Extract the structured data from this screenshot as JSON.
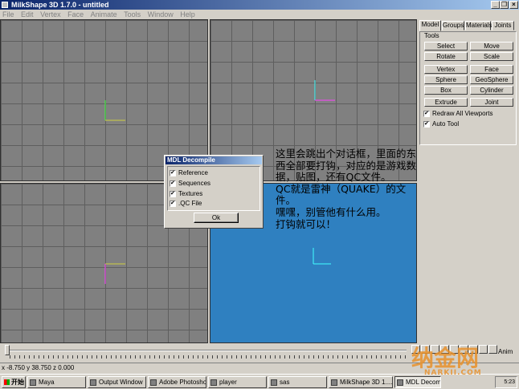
{
  "window": {
    "title": "MilkShape 3D 1.7.0 - untitled",
    "minimize_glyph": "_",
    "restore_glyph": "❐",
    "close_glyph": "×"
  },
  "menu": [
    "File",
    "Edit",
    "Vertex",
    "Face",
    "Animate",
    "Tools",
    "Window",
    "Help"
  ],
  "panel": {
    "tabs": [
      "Model",
      "Groups",
      "Materials",
      "Joints"
    ],
    "active_tab": "Model",
    "tools_label": "Tools",
    "buttons": [
      "Select",
      "Move",
      "Rotate",
      "Scale",
      "Vertex",
      "Face",
      "Sphere",
      "GeoSphere",
      "Box",
      "Cylinder",
      "Extrude",
      "Joint"
    ],
    "checkboxes": [
      {
        "label": "Redraw All Viewports",
        "checked": true
      },
      {
        "label": "Auto Tool",
        "checked": true
      }
    ]
  },
  "dialog": {
    "title": "MDL Decompile",
    "options": [
      {
        "label": "Reference",
        "checked": true
      },
      {
        "label": "Sequences",
        "checked": true
      },
      {
        "label": "Textures",
        "checked": true
      },
      {
        "label": ".QC File",
        "checked": true
      }
    ],
    "ok_label": "Ok"
  },
  "annotation": {
    "lines": [
      "这里会跳出个对话框，里面的东",
      "西全部要打钩，对应的是游戏数",
      "据，贴图，还有QC文件。",
      "QC就是雷神（QUAKE）的文件。",
      "嘿嘿，别管他有什么用。",
      "打钩就可以！"
    ]
  },
  "timeline": {
    "anim_label": "Anim"
  },
  "status": {
    "coords": "x -8.750 y 38.750 z 0.000"
  },
  "taskbar": {
    "start_label": "开始",
    "tasks": [
      "Maya",
      "Output Window",
      "Adobe Photoshop",
      "player",
      "sas",
      "MilkShape 3D 1....",
      "MDL Decomp..."
    ],
    "pressed_task": "MDL Decomp...",
    "clock": "5:23"
  },
  "watermark": {
    "text": "纳金网",
    "url_text": "NARKII.COM"
  },
  "colors": {
    "viewport_gray": "#808080",
    "viewport_blue": "#2f80c0",
    "axis_green": "#40ff40",
    "axis_yellow": "#d0d040",
    "axis_magenta": "#ff40ff",
    "axis_cyan": "#40ffff",
    "watermark_orange": "#e8902a"
  }
}
